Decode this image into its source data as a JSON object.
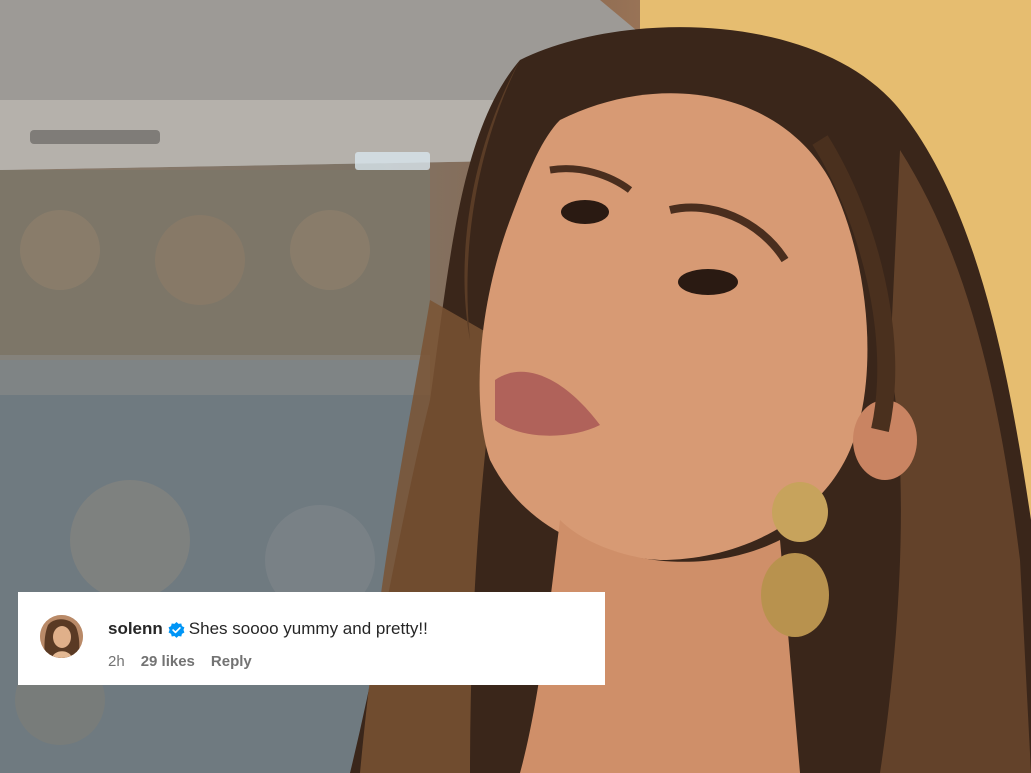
{
  "photo": {
    "icon": "portrait-photo"
  },
  "comment": {
    "username": "solenn",
    "verified_icon": "verified-badge-icon",
    "text": "Shes soooo yummy and pretty!!",
    "time": "2h",
    "likes": "29 likes",
    "reply": "Reply"
  },
  "colors": {
    "card_background": "#ffffff",
    "text_primary": "#262626",
    "text_secondary": "#737373",
    "verified_blue": "#0095f6"
  }
}
